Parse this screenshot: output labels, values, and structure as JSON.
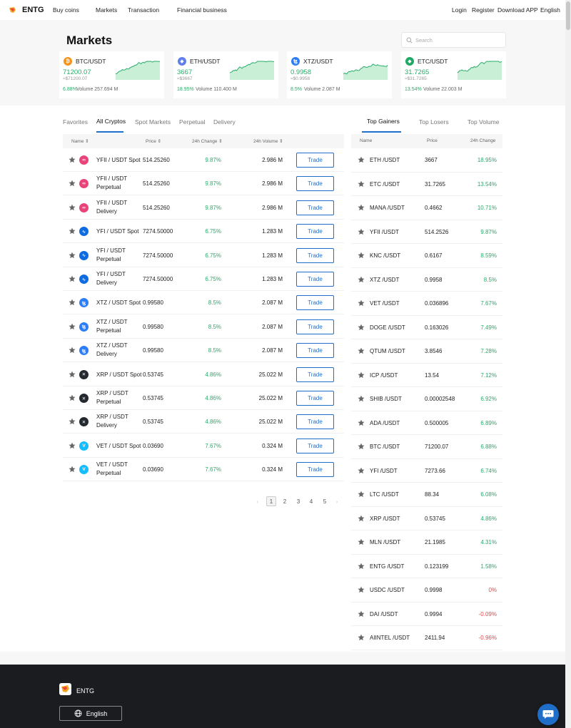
{
  "nav": {
    "brand": "ENTG",
    "left": [
      "Buy coins",
      "Markets",
      "Transaction",
      "Financial business"
    ],
    "right": [
      "Login",
      "Register",
      "Download APP",
      "English"
    ]
  },
  "page_title": "Markets",
  "search": {
    "placeholder": "Search"
  },
  "tickers": [
    {
      "pair": "BTC/USDT",
      "price": "71200.07",
      "approx": "≈$71200.07",
      "change": "6.88%",
      "volume": "Volume 257.694 M",
      "icon": "bitcoin-icon",
      "color": "#f7931a"
    },
    {
      "pair": "ETH/USDT",
      "price": "3667",
      "approx": "≈$3667",
      "change": "18.95%",
      "volume": "Volume 110.400 M",
      "icon": "ethereum-icon",
      "color": "#627eea"
    },
    {
      "pair": "XTZ/USDT",
      "price": "0.9958",
      "approx": "≈$0.9958",
      "change": "8.5%",
      "volume": "Volume 2.087 M",
      "icon": "tezos-icon",
      "color": "#2c7df7"
    },
    {
      "pair": "ETC/USDT",
      "price": "31.7265",
      "approx": "≈$31.7265",
      "change": "13.54%",
      "volume": "Volume 22.003 M",
      "icon": "ethereum-classic-icon",
      "color": "#20a866"
    }
  ],
  "market_tabs": [
    "Favorites",
    "All Cryptos",
    "Spot Markets",
    "Perpetual",
    "Delivery"
  ],
  "market_active_tab": "All Cryptos",
  "market_headers": {
    "name": "Name",
    "price": "Price",
    "change": "24h Change",
    "volume": "24h Volume"
  },
  "trade_label": "Trade",
  "markets": [
    {
      "name": "YFII / USDT Spot",
      "price": "514.25260",
      "change": "9.87%",
      "volume": "2.986 M",
      "coin": "yfii-icon",
      "color": "#e8447a",
      "glyph": "∞"
    },
    {
      "name": "YFII / USDT Perpetual",
      "price": "514.25260",
      "change": "9.87%",
      "volume": "2.986 M",
      "coin": "yfii-icon",
      "color": "#e8447a",
      "glyph": "∞"
    },
    {
      "name": "YFII / USDT Delivery",
      "price": "514.25260",
      "change": "9.87%",
      "volume": "2.986 M",
      "coin": "yfii-icon",
      "color": "#e8447a",
      "glyph": "∞"
    },
    {
      "name": "YFI / USDT Spot",
      "price": "7274.50000",
      "change": "6.75%",
      "volume": "1.283 M",
      "coin": "yfi-icon",
      "color": "#0e6be0",
      "glyph": "∿"
    },
    {
      "name": "YFI / USDT Perpetual",
      "price": "7274.50000",
      "change": "6.75%",
      "volume": "1.283 M",
      "coin": "yfi-icon",
      "color": "#0e6be0",
      "glyph": "∿"
    },
    {
      "name": "YFI / USDT Delivery",
      "price": "7274.50000",
      "change": "6.75%",
      "volume": "1.283 M",
      "coin": "yfi-icon",
      "color": "#0e6be0",
      "glyph": "∿"
    },
    {
      "name": "XTZ / USDT Spot",
      "price": "0.99580",
      "change": "8.5%",
      "volume": "2.087 M",
      "coin": "tezos-icon",
      "color": "#2c7df7",
      "glyph": "ꜩ"
    },
    {
      "name": "XTZ / USDT Perpetual",
      "price": "0.99580",
      "change": "8.5%",
      "volume": "2.087 M",
      "coin": "tezos-icon",
      "color": "#2c7df7",
      "glyph": "ꜩ"
    },
    {
      "name": "XTZ / USDT Delivery",
      "price": "0.99580",
      "change": "8.5%",
      "volume": "2.087 M",
      "coin": "tezos-icon",
      "color": "#2c7df7",
      "glyph": "ꜩ"
    },
    {
      "name": "XRP / USDT Spot",
      "price": "0.53745",
      "change": "4.86%",
      "volume": "25.022 M",
      "coin": "xrp-icon",
      "color": "#23292f",
      "glyph": "✕"
    },
    {
      "name": "XRP / USDT Perpetual",
      "price": "0.53745",
      "change": "4.86%",
      "volume": "25.022 M",
      "coin": "xrp-icon",
      "color": "#23292f",
      "glyph": "✕"
    },
    {
      "name": "XRP / USDT Delivery",
      "price": "0.53745",
      "change": "4.86%",
      "volume": "25.022 M",
      "coin": "xrp-icon",
      "color": "#23292f",
      "glyph": "✕"
    },
    {
      "name": "VET / USDT Spot",
      "price": "0.03690",
      "change": "7.67%",
      "volume": "0.324 M",
      "coin": "vechain-icon",
      "color": "#15bdff",
      "glyph": "V"
    },
    {
      "name": "VET / USDT Perpetual",
      "price": "0.03690",
      "change": "7.67%",
      "volume": "0.324 M",
      "coin": "vechain-icon",
      "color": "#15bdff",
      "glyph": "V"
    }
  ],
  "pagination": {
    "pages": [
      "1",
      "2",
      "3",
      "4",
      "5"
    ],
    "current": "1",
    "prev_icon": "‹",
    "next_icon": "›"
  },
  "gainer_tabs": [
    "Top Gainers",
    "Top Losers",
    "Top Volume"
  ],
  "gainer_active_tab": "Top Gainers",
  "gainer_headers": {
    "name": "Name",
    "price": "Price",
    "change": "24h Change"
  },
  "gainers": [
    {
      "name": "ETH /USDT",
      "price": "3667",
      "change": "18.95%",
      "dir": "pos"
    },
    {
      "name": "ETC /USDT",
      "price": "31.7265",
      "change": "13.54%",
      "dir": "pos"
    },
    {
      "name": "MANA /USDT",
      "price": "0.4662",
      "change": "10.71%",
      "dir": "pos"
    },
    {
      "name": "YFII /USDT",
      "price": "514.2526",
      "change": "9.87%",
      "dir": "pos"
    },
    {
      "name": "KNC /USDT",
      "price": "0.6167",
      "change": "8.59%",
      "dir": "pos"
    },
    {
      "name": "XTZ /USDT",
      "price": "0.9958",
      "change": "8.5%",
      "dir": "pos"
    },
    {
      "name": "VET /USDT",
      "price": "0.036896",
      "change": "7.67%",
      "dir": "pos"
    },
    {
      "name": "DOGE /USDT",
      "price": "0.163026",
      "change": "7.49%",
      "dir": "pos"
    },
    {
      "name": "QTUM /USDT",
      "price": "3.8546",
      "change": "7.28%",
      "dir": "pos"
    },
    {
      "name": "ICP /USDT",
      "price": "13.54",
      "change": "7.12%",
      "dir": "pos"
    },
    {
      "name": "SHIB /USDT",
      "price": "0.00002548",
      "change": "6.92%",
      "dir": "pos"
    },
    {
      "name": "ADA /USDT",
      "price": "0.500005",
      "change": "6.89%",
      "dir": "pos"
    },
    {
      "name": "BTC /USDT",
      "price": "71200.07",
      "change": "6.88%",
      "dir": "pos"
    },
    {
      "name": "YFI /USDT",
      "price": "7273.66",
      "change": "6.74%",
      "dir": "pos"
    },
    {
      "name": "LTC /USDT",
      "price": "88.34",
      "change": "6.08%",
      "dir": "pos"
    },
    {
      "name": "XRP /USDT",
      "price": "0.53745",
      "change": "4.86%",
      "dir": "pos"
    },
    {
      "name": "MLN /USDT",
      "price": "21.1985",
      "change": "4.31%",
      "dir": "pos"
    },
    {
      "name": "ENTG /USDT",
      "price": "0.123199",
      "change": "1.58%",
      "dir": "pos"
    },
    {
      "name": "USDC /USDT",
      "price": "0.9998",
      "change": "0%",
      "dir": "neg"
    },
    {
      "name": "DAI /USDT",
      "price": "0.9994",
      "change": "-0.09%",
      "dir": "neg"
    },
    {
      "name": "AIINTEL /USDT",
      "price": "2411.94",
      "change": "-0.96%",
      "dir": "neg"
    }
  ],
  "footer": {
    "brand": "ENTG",
    "language_button": "English"
  },
  "colors": {
    "accent": "#1f6fc9",
    "positive": "#2aab6b",
    "negative": "#e5484d",
    "footer_bg": "#1b1c1f"
  }
}
